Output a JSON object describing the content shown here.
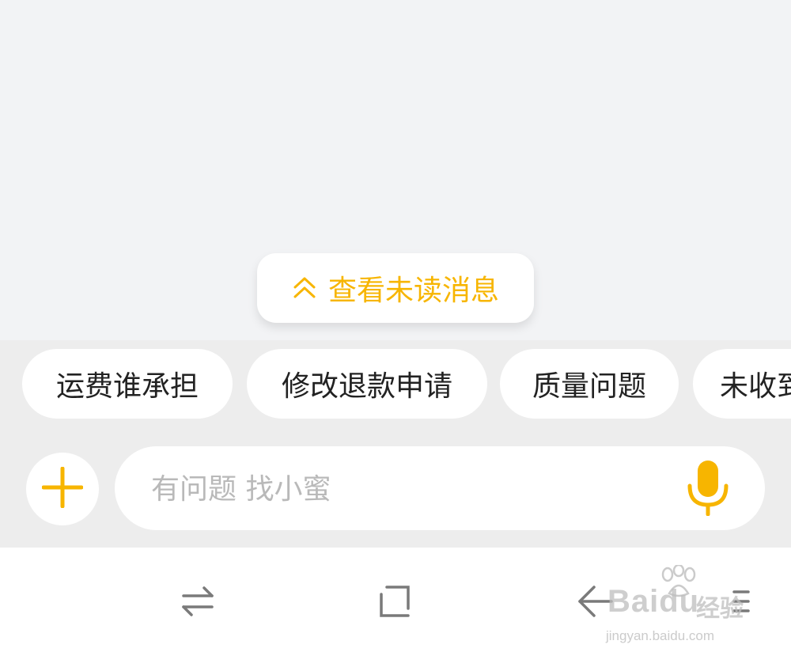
{
  "chat": {
    "unread_button_label": "查看未读消息",
    "unread_icon": "double-chevron-up-icon"
  },
  "quick_replies": [
    "运费谁承担",
    "修改退款申请",
    "质量问题",
    "未收到"
  ],
  "composer": {
    "plus_icon": "plus-icon",
    "input_placeholder": "有问题 找小蜜",
    "mic_icon": "microphone-icon"
  },
  "nav_bar": {
    "items": [
      "switch-apps-icon",
      "home-square-icon",
      "back-arrow-icon",
      "menu-icon"
    ]
  },
  "watermark": {
    "brand": "Baidu",
    "brand_cn": "经验",
    "url": "jingyan.baidu.com"
  },
  "colors": {
    "accent": "#f7b500",
    "background": "#f2f3f5",
    "panel": "#ededed",
    "chip_text": "#222222",
    "placeholder": "#b9b9b9"
  }
}
